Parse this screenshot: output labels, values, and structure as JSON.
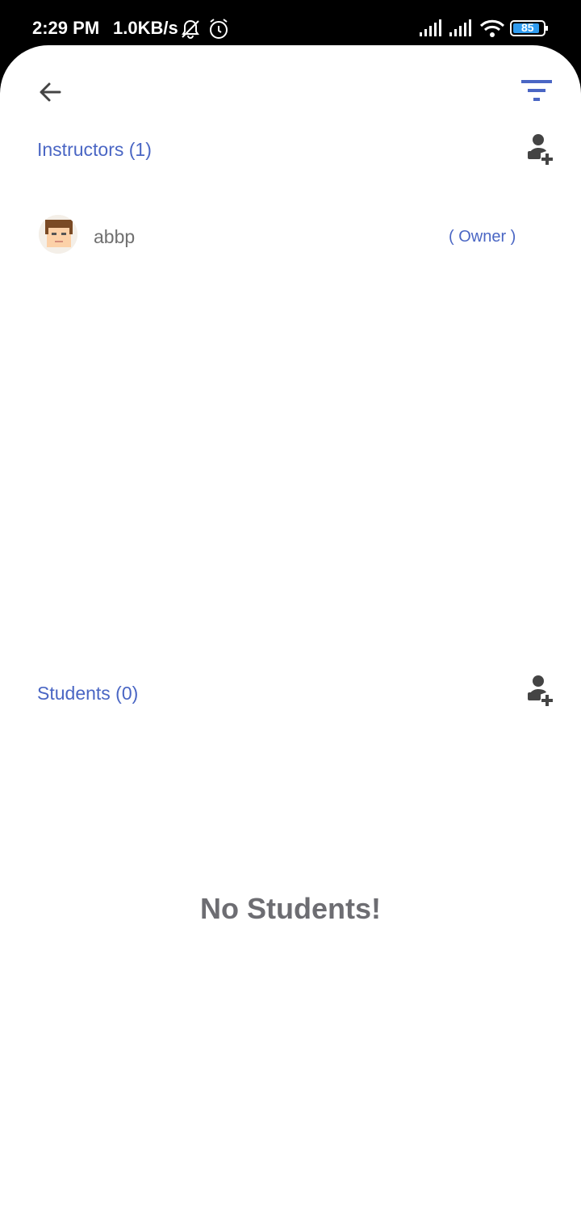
{
  "status": {
    "time": "2:29 PM",
    "speed": "1.0KB/s",
    "battery": "85"
  },
  "instructors": {
    "title": "Instructors (1)",
    "items": [
      {
        "name": "abbp",
        "role": "( Owner )"
      }
    ]
  },
  "students": {
    "title": "Students (0)",
    "empty_message": "No Students!"
  },
  "colors": {
    "accent": "#4a66c4",
    "text_muted": "#707070",
    "icon_dark": "#444444"
  }
}
